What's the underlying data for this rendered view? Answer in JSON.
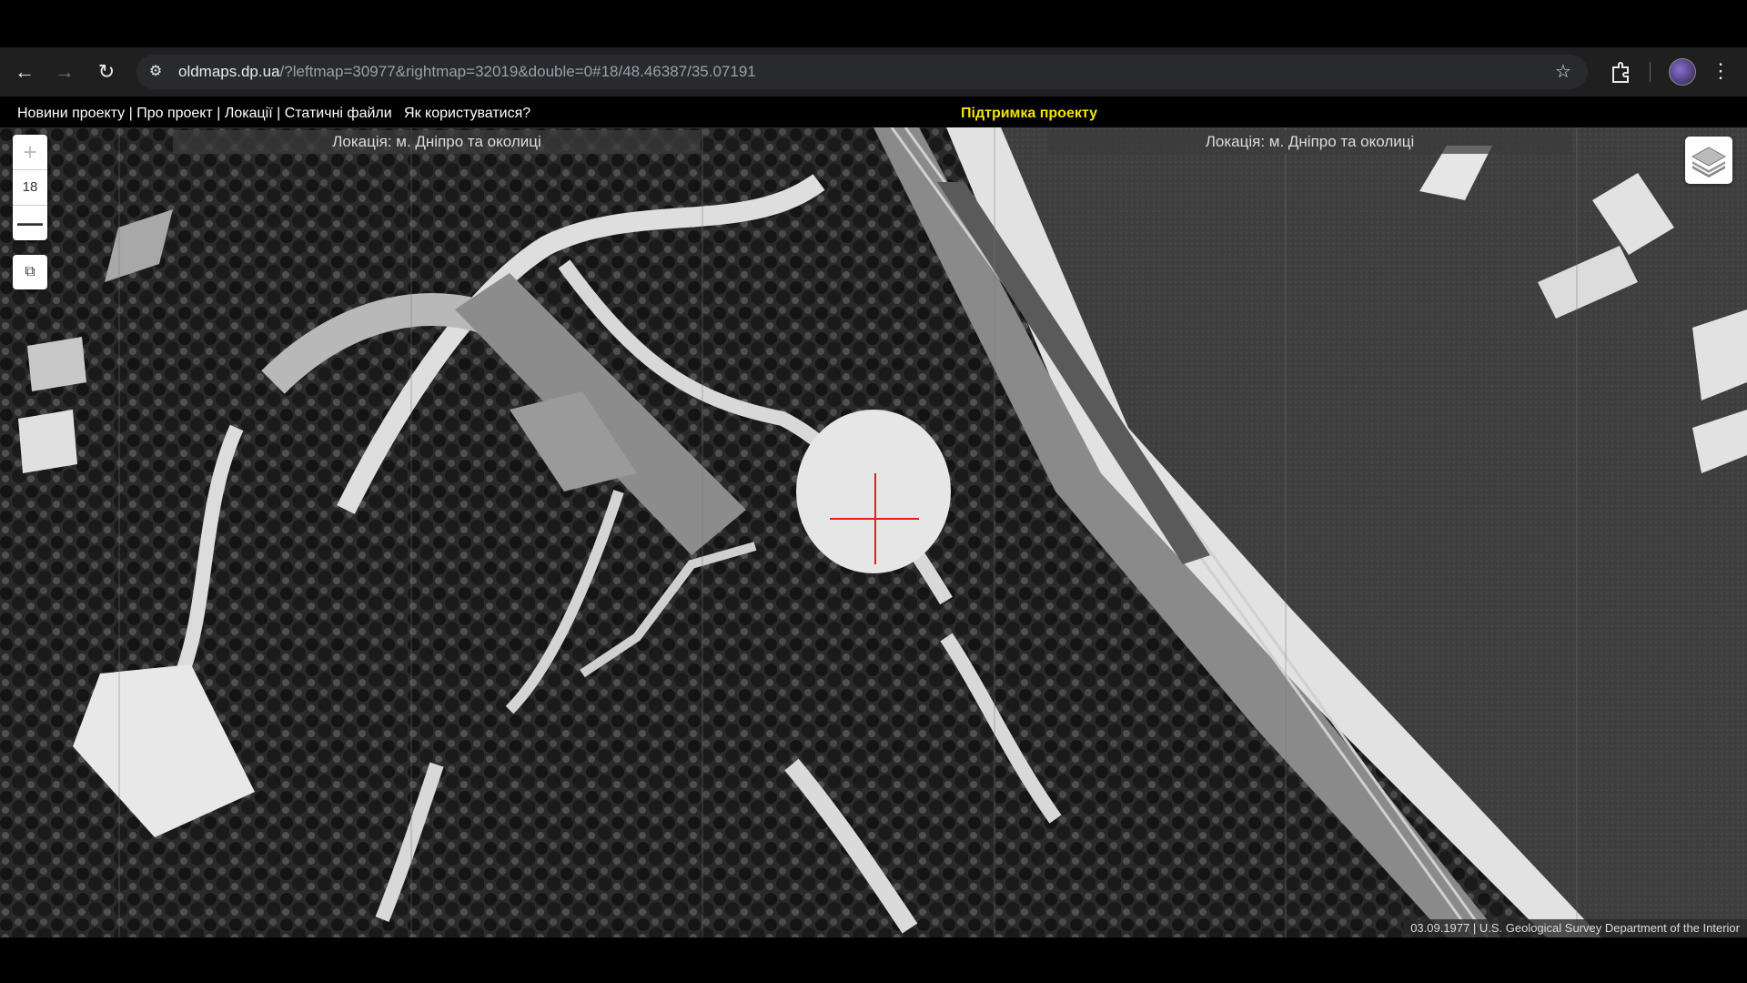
{
  "browser": {
    "url_host": "oldmaps.dp.ua",
    "url_path": "/?leftmap=30977&rightmap=32019&double=0#18/48.46387/35.07191",
    "icons": [
      "back-arrow-icon",
      "forward-arrow-icon",
      "reload-icon",
      "site-info-icon",
      "bookmark-star-icon",
      "extensions-icon",
      "profile-avatar",
      "more-menu-icon"
    ]
  },
  "site_nav": {
    "links": [
      "Новини проекту",
      " | ",
      "Про проект",
      " | ",
      "Локації",
      " | ",
      "Статичні файли",
      "   ",
      "Як користуватися?"
    ],
    "support": "Підтримка проекту",
    "support_color": "#f5e400"
  },
  "map": {
    "left_label": "Локація: м. Дніпро та околиці",
    "right_label": "Локація: м. Дніпро та околиці",
    "zoom_in": "+",
    "zoom_level": "18",
    "zoom_out": "—",
    "swap_icon": "⧉",
    "attribution": "03.09.1977 | U.S. Geological Survey Department of the Interior",
    "crosshair_color": "#e02020",
    "imagery": "black-and-white aerial photograph"
  }
}
